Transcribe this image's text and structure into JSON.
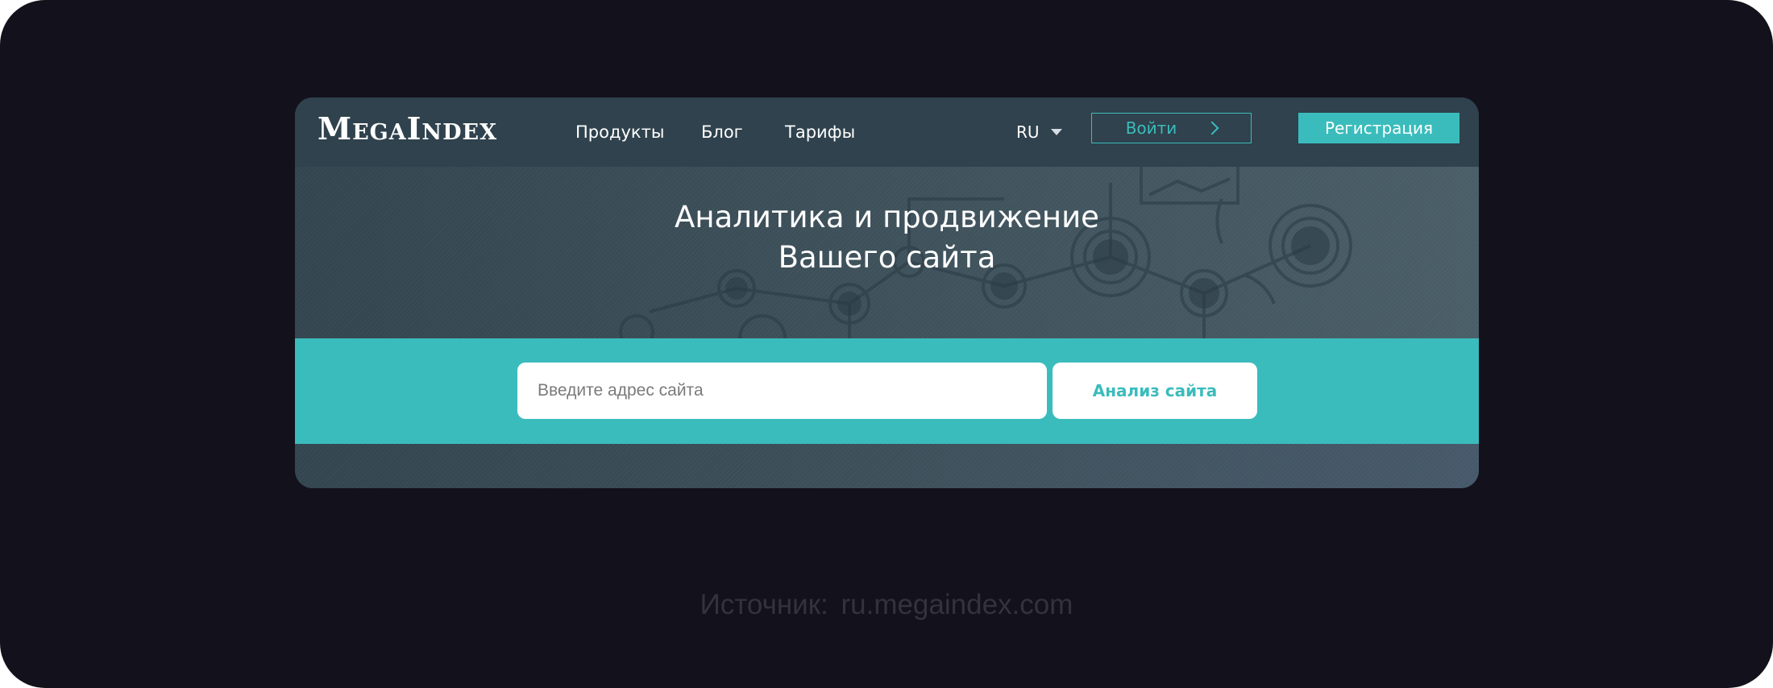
{
  "header": {
    "logo": "MegaIndex",
    "nav": [
      "Продукты",
      "Блог",
      "Тарифы"
    ],
    "lang": "RU",
    "login_label": "Войти",
    "register_label": "Регистрация"
  },
  "hero": {
    "title_line1": "Аналитика и продвижение",
    "title_line2": "Вашего сайта"
  },
  "search": {
    "placeholder": "Введите адрес сайта",
    "value": "",
    "button_label": "Анализ сайта"
  },
  "source": {
    "label": "Источник:",
    "url": "ru.megaindex.com"
  },
  "colors": {
    "background": "#13111c",
    "header": "#2f424d",
    "accent": "#3bbcbc",
    "text": "#ffffff"
  },
  "icons": {
    "lang_caret": "chevron-down-icon",
    "login_arrow": "chevron-right-icon"
  }
}
